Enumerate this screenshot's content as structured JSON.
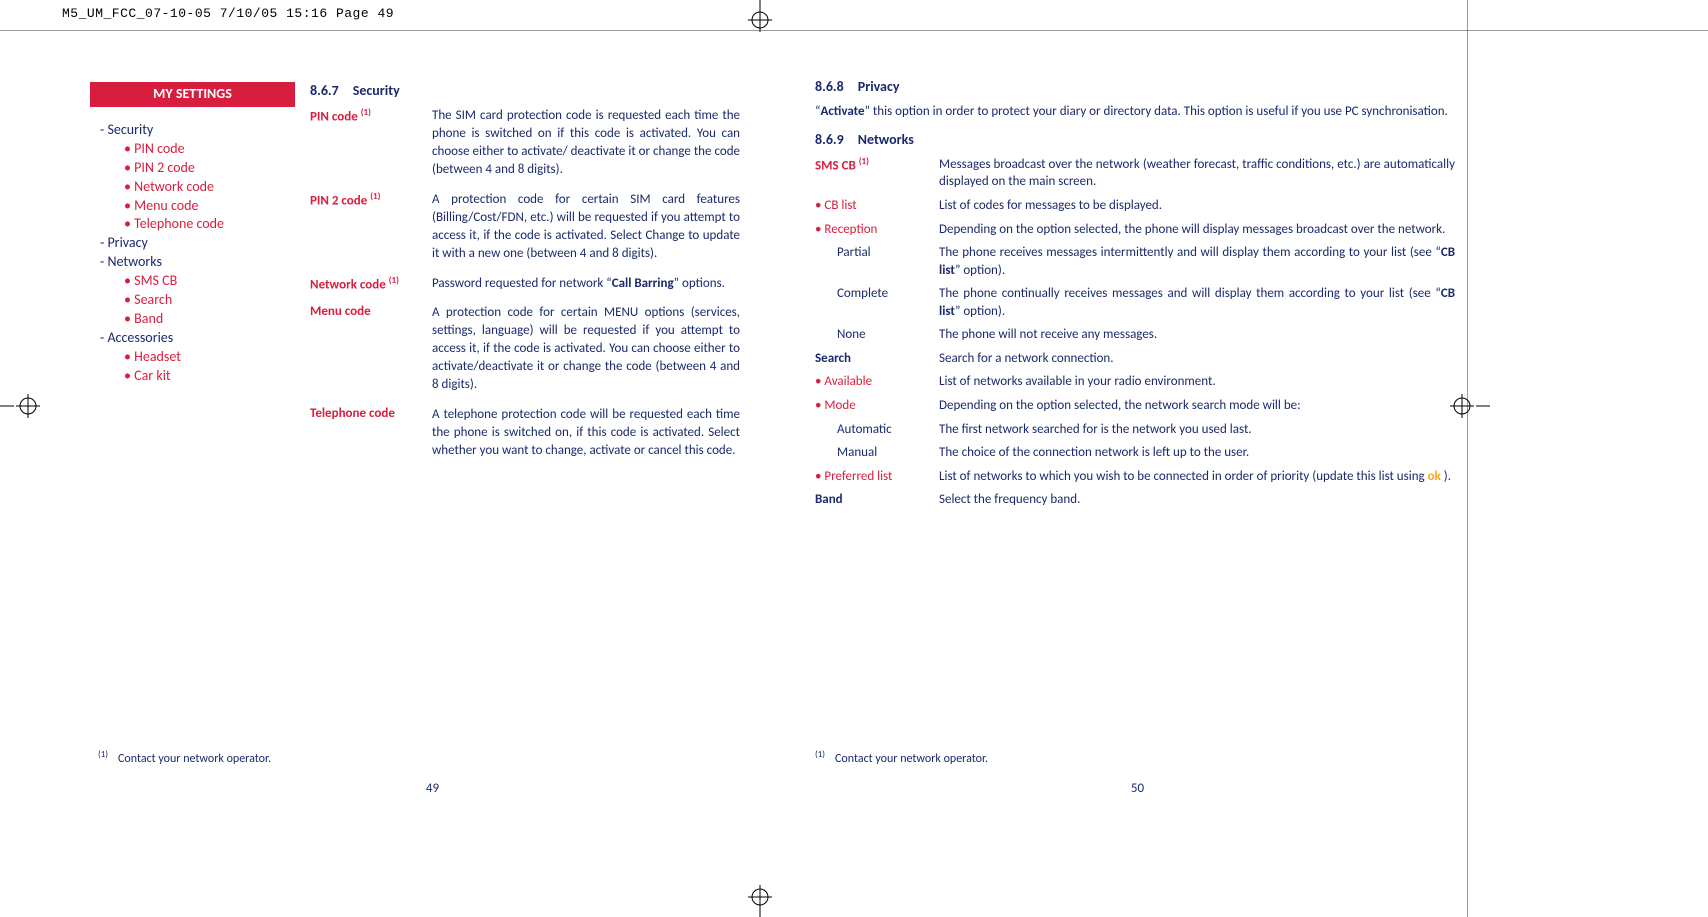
{
  "slug": "M5_UM_FCC_07-10-05  7/10/05  15:16  Page 49",
  "sidebar": {
    "title": "MY SETTINGS",
    "items": [
      {
        "label": "Security",
        "children": [
          "PIN code",
          "PIN 2 code",
          "Network code",
          "Menu code",
          "Telephone code"
        ]
      },
      {
        "label": "Privacy",
        "children": []
      },
      {
        "label": "Networks",
        "children": [
          "SMS CB",
          "Search",
          "Band"
        ]
      },
      {
        "label": "Accessories",
        "children": [
          "Headset",
          "Car kit"
        ]
      }
    ]
  },
  "left": {
    "section_no": "8.6.7",
    "section_title": "Security",
    "pin_label": "PIN code ",
    "pin_body": "The SIM card protection code is requested each time the phone is switched on if this code is activated. You can choose either to activate/ deactivate it or change the code (between 4 and 8 digits).",
    "pin2_label": "PIN 2 code ",
    "pin2_body": "A protection code for certain SIM card features (Billing/Cost/FDN, etc.) will be requested if you attempt to access it, if the code is activated. Select Change to update it with a new one (between 4 and 8 digits).",
    "net_label": "Network code ",
    "net_body_a": "Password requested for network “",
    "net_body_bold": "Call Barring",
    "net_body_b": "” options.",
    "menu_label": "Menu code",
    "menu_body": "A protection code for certain MENU options (services, settings, language) will be requested if you attempt to access it, if the code is activated. You can choose either to activate/deactivate it or change the code (between 4 and 8 digits).",
    "tel_label": "Telephone code",
    "tel_body": "A telephone protection code will be requested each time the phone is switched on, if this code is activated. Select whether you want to change, activate or cancel this code.",
    "footnote": "Contact your network operator.",
    "page_num": "49"
  },
  "right": {
    "sec1_no": "8.6.8",
    "sec1_title": "Privacy",
    "privacy_a": "“",
    "privacy_bold": "Activate",
    "privacy_b": "” this option in order to protect your diary or directory data. This option is useful if you use PC synchronisation.",
    "sec2_no": "8.6.9",
    "sec2_title": "Networks",
    "rows": {
      "smscb_label": "SMS CB ",
      "smscb_body": "Messages broadcast over the network (weather forecast, traffic conditions, etc.) are automatically displayed on the main screen.",
      "cblist_label": "CB list",
      "cblist_body": "List of codes for messages to be displayed.",
      "reception_label": "Reception",
      "reception_body": "Depending on the option selected, the phone will display messages broadcast over the network.",
      "partial_label": "Partial",
      "partial_a": "The phone receives messages intermittently and will display them according to your list (see “",
      "partial_bold": "CB list",
      "partial_b": "” option).",
      "complete_label": "Complete",
      "complete_a": "The phone continually receives messages and will display them according to your list (see “",
      "complete_bold": "CB list",
      "complete_b": "” option).",
      "none_label": "None",
      "none_body": "The phone will not receive any messages.",
      "search_label": "Search",
      "search_body": "Search for a network connection.",
      "avail_label": "Available",
      "avail_body": "List of networks available in your radio environment.",
      "mode_label": "Mode",
      "mode_body": "Depending on the option selected, the network search mode will be:",
      "auto_label": "Automatic",
      "auto_body": "The first network searched for is the network you used last.",
      "manual_label": "Manual",
      "manual_body": "The choice of the connection network is left up to the user.",
      "pref_label": "Preferred list",
      "pref_a": "List of networks to which you wish to be connected in order of priority (update this list using ",
      "pref_ok": "ok",
      "pref_b": " ).",
      "band_label": "Band",
      "band_body": "Select the frequency band."
    },
    "footnote": "Contact your network operator.",
    "page_num": "50"
  },
  "sup_mark": "(1)"
}
